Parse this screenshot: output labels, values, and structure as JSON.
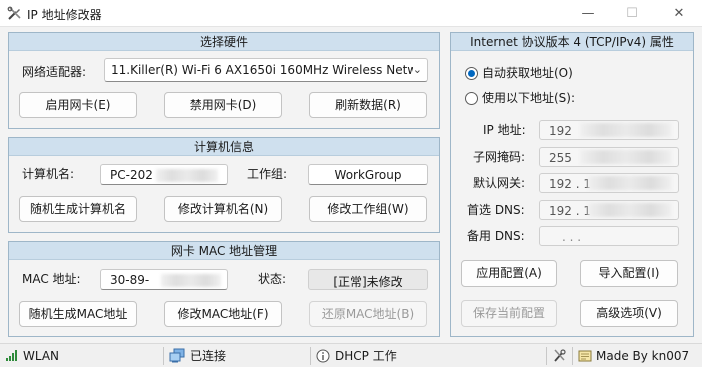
{
  "window": {
    "title": "IP 地址修改器",
    "minimize": "—",
    "maximize": "☐",
    "close": "✕"
  },
  "hardware": {
    "title": "选择硬件",
    "adapter_label": "网络适配器:",
    "adapter_value": "11.Killer(R) Wi-Fi 6 AX1650i 160MHz Wireless Netw",
    "enable_btn": "启用网卡(E)",
    "disable_btn": "禁用网卡(D)",
    "refresh_btn": "刷新数据(R)"
  },
  "computer": {
    "title": "计算机信息",
    "name_label": "计算机名:",
    "name_value": "PC-202",
    "workgroup_label": "工作组:",
    "workgroup_value": "WorkGroup",
    "random_name_btn": "随机生成计算机名",
    "modify_name_btn": "修改计算机名(N)",
    "modify_wg_btn": "修改工作组(W)"
  },
  "mac": {
    "title": "网卡 MAC 地址管理",
    "mac_label": "MAC 地址:",
    "mac_value": "30-89-",
    "status_label": "状态:",
    "status_value": "[正常]未修改",
    "random_btn": "随机生成MAC地址",
    "modify_btn": "修改MAC地址(F)",
    "restore_btn": "还原MAC地址(B)"
  },
  "ipv4": {
    "title": "Internet 协议版本 4 (TCP/IPv4) 属性",
    "auto_label": "自动获取地址(O)",
    "manual_label": "使用以下地址(S):",
    "ip_label": "IP 地址:",
    "ip_value": "192",
    "mask_label": "子网掩码:",
    "mask_value": "255",
    "gateway_label": "默认网关:",
    "gateway_value": "192 . 1",
    "dns1_label": "首选 DNS:",
    "dns1_value": "192 . 1",
    "dns2_label": "备用 DNS:",
    "dns2_value": ".           .           .",
    "apply_btn": "应用配置(A)",
    "import_btn": "导入配置(I)",
    "save_btn": "保存当前配置",
    "advanced_btn": "高级选项(V)"
  },
  "statusbar": {
    "network": "WLAN",
    "connection": "已连接",
    "dhcp": "DHCP 工作",
    "credit": "Made By kn007"
  }
}
